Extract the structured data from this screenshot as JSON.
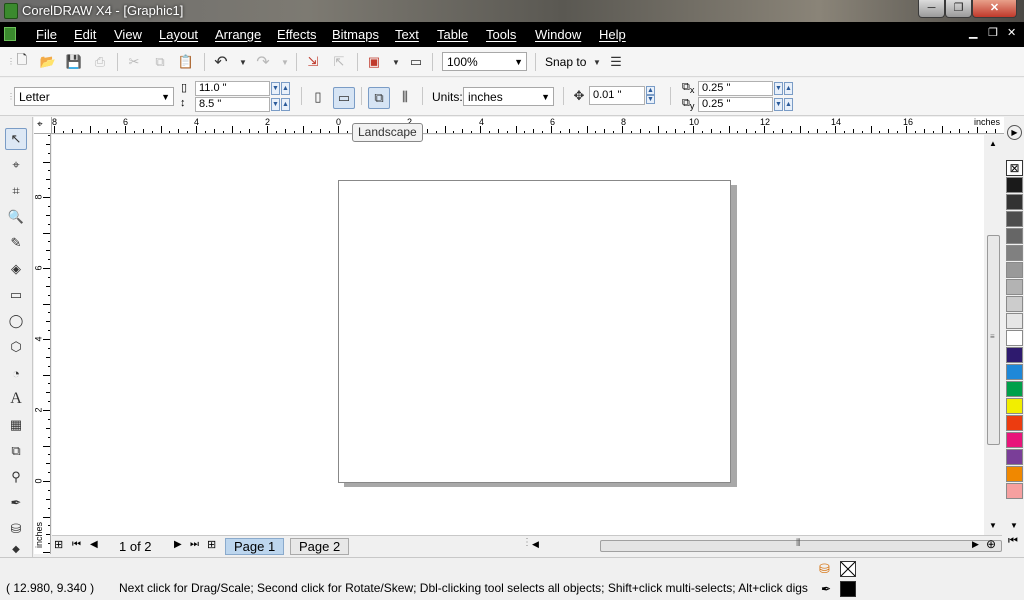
{
  "window": {
    "title": "CorelDRAW X4 - [Graphic1]",
    "controls": {
      "minimize": "─",
      "maximize": "❐",
      "close": "✕"
    }
  },
  "menu": {
    "items": [
      "File",
      "Edit",
      "View",
      "Layout",
      "Arrange",
      "Effects",
      "Bitmaps",
      "Text",
      "Table",
      "Tools",
      "Window",
      "Help"
    ]
  },
  "standard_toolbar": {
    "zoom_level": "100%",
    "snap_to_label": "Snap to"
  },
  "property_bar": {
    "paper_size": "Letter",
    "page_width": "11.0 \"",
    "page_height": "8.5 \"",
    "units_label": "Units:",
    "units_value": "inches",
    "nudge_distance": "0.01 \"",
    "duplicate_x": "0.25 \"",
    "duplicate_y": "0.25 \"",
    "duplicate_x_label": "x",
    "duplicate_y_label": "y"
  },
  "tooltip": "Landscape",
  "rulers": {
    "horizontal_labels": [
      "8",
      "6",
      "4",
      "2",
      "0",
      "2",
      "4",
      "6",
      "8",
      "10",
      "12",
      "14",
      "16"
    ],
    "horizontal_unit": "inches",
    "vertical_labels": [
      "8",
      "6",
      "4",
      "2",
      "0"
    ],
    "vertical_unit": "inches"
  },
  "page_navigator": {
    "page_count": "1 of 2",
    "tabs": [
      "Page 1",
      "Page 2"
    ]
  },
  "status_bar": {
    "coordinates": "( 12.980, 9.340 )",
    "message": "Next click for Drag/Scale; Second click for Rotate/Skew; Dbl-clicking tool selects all objects; Shift+click multi-selects; Alt+click digs"
  },
  "palette_colors": [
    "#1a1a1a",
    "#333333",
    "#4d4d4d",
    "#666666",
    "#808080",
    "#999999",
    "#b3b3b3",
    "#cccccc",
    "#e6e6e6",
    "#ffffff",
    "#2e1a6e",
    "#1e88d8",
    "#00a04a",
    "#f2ee00",
    "#ec3c10",
    "#e8147a",
    "#7a3e98",
    "#f08800",
    "#f6a0a0"
  ]
}
